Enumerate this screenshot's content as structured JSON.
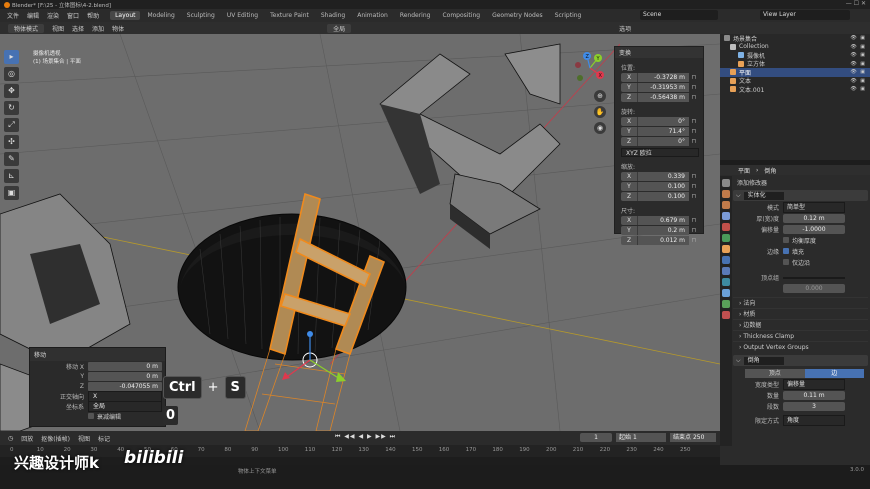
{
  "titlebar": {
    "title": "Blender* [F:\\25 - 立体图标\\4-2.blend]",
    "controls": "—  ☐  ✕"
  },
  "menu": {
    "items": [
      "文件",
      "编辑",
      "渲染",
      "窗口",
      "帮助"
    ],
    "workspaces": [
      "Layout",
      "Modeling",
      "Sculpting",
      "UV Editing",
      "Texture Paint",
      "Shading",
      "Animation",
      "Rendering",
      "Compositing",
      "Geometry Nodes",
      "Scripting"
    ],
    "active_workspace": "Layout",
    "scene": "Scene",
    "view_layer": "View Layer"
  },
  "viewport_header": {
    "mode": "物体模式",
    "menus": [
      "视图",
      "选择",
      "添加",
      "物体"
    ],
    "orientation": "全局",
    "options": "选项"
  },
  "viewport_info": {
    "line1": "摄像机透视",
    "line2": "(1) 场景集合 | 平面"
  },
  "gizmo": {
    "x": "X",
    "y": "Y",
    "z": "Z"
  },
  "npanel": {
    "title": "变换",
    "location_label": "位置:",
    "location": [
      {
        "axis": "X",
        "value": "-0.3728 m"
      },
      {
        "axis": "Y",
        "value": "-0.31953 m"
      },
      {
        "axis": "Z",
        "value": "-0.56438 m"
      }
    ],
    "rotation_label": "旋转:",
    "rotation": [
      {
        "axis": "X",
        "value": "0°"
      },
      {
        "axis": "Y",
        "value": "71.4°"
      },
      {
        "axis": "Z",
        "value": "0°"
      }
    ],
    "rotation_mode": "XYZ 欧拉",
    "scale_label": "缩放:",
    "scale": [
      {
        "axis": "X",
        "value": "0.339"
      },
      {
        "axis": "Y",
        "value": "0.100"
      },
      {
        "axis": "Z",
        "value": "0.100"
      }
    ],
    "dimensions_label": "尺寸:",
    "dimensions": [
      {
        "axis": "X",
        "value": "0.679 m"
      },
      {
        "axis": "Y",
        "value": "0.2 m"
      },
      {
        "axis": "Z",
        "value": "0.012 m"
      }
    ]
  },
  "operator_panel": {
    "title": "移动",
    "move_label": "移动 X",
    "move": [
      {
        "label": "移动 X",
        "value": "0 m"
      },
      {
        "label": "Y",
        "value": "0 m"
      },
      {
        "label": "Z",
        "value": "-0.047055 m"
      }
    ],
    "orient_axis_label": "正交轴向",
    "orient_axis": "X",
    "orient_label": "坐标系",
    "orient": "全局",
    "proportional": "衰减编辑"
  },
  "keys": {
    "k1": "Ctrl",
    "plus": "+",
    "k2": "S",
    "k3": "0"
  },
  "outliner": {
    "header": "场景集合",
    "rows": [
      {
        "label": "场景集合",
        "color": "#8a8a8a",
        "indent": 0,
        "selected": false
      },
      {
        "label": "Collection",
        "color": "#bdbdbd",
        "indent": 6,
        "selected": false
      },
      {
        "label": "摄像机",
        "color": "#7fb2e5",
        "indent": 14,
        "selected": false
      },
      {
        "label": "立方体",
        "color": "#e8a157",
        "indent": 14,
        "selected": false
      },
      {
        "label": "平面",
        "color": "#e8a157",
        "indent": 6,
        "selected": true
      },
      {
        "label": "文本",
        "color": "#e8a157",
        "indent": 6,
        "selected": false
      },
      {
        "label": "文本.001",
        "color": "#e8a157",
        "indent": 6,
        "selected": false
      }
    ],
    "vis": "👁 ▣"
  },
  "properties": {
    "object": "平面",
    "modifier_stack": "倒角",
    "add_modifier": "添加修改器",
    "solidify": {
      "name": "实体化",
      "mode_label": "模式",
      "mode": "简单型",
      "thickness_label": "厚(宽)度",
      "thickness": "0.12 m",
      "offset_label": "偏移量",
      "offset": "-1.0000",
      "even_label": "均衡厚度",
      "rim_label": "边缘",
      "rim_fill": "填充",
      "rim_only": "仅边沿",
      "vgroup_label": "顶点组",
      "factor": "0.000"
    },
    "sections": [
      "法向",
      "材质",
      "边数据",
      "Thickness Clamp",
      "Output Vertex Groups"
    ],
    "bevel": {
      "name": "倒角",
      "tab_vertex": "顶点",
      "tab_edge": "边",
      "width_type_label": "宽度类型",
      "width_type": "偏移量",
      "amount_label": "数量",
      "amount": "0.11 m",
      "segments_label": "段数",
      "segments": "3",
      "limit_label": "限定方式",
      "limit": "角度"
    }
  },
  "timeline": {
    "menus": [
      "回放",
      "抠像(插帧)",
      "视图",
      "标记"
    ],
    "frame": "1",
    "start_label": "起始",
    "start": "1",
    "end_label": "结束点",
    "end": "250",
    "ruler": [
      "0",
      "10",
      "20",
      "30",
      "40",
      "50",
      "60",
      "70",
      "80",
      "90",
      "100",
      "110",
      "120",
      "130",
      "140",
      "150",
      "160",
      "170",
      "180",
      "190",
      "200",
      "210",
      "220",
      "230",
      "240",
      "250"
    ]
  },
  "status": {
    "text": "物体上下文菜单",
    "version": "3.0.0"
  },
  "watermark": {
    "text": "兴趣设计师k",
    "logo": "bilibili"
  }
}
